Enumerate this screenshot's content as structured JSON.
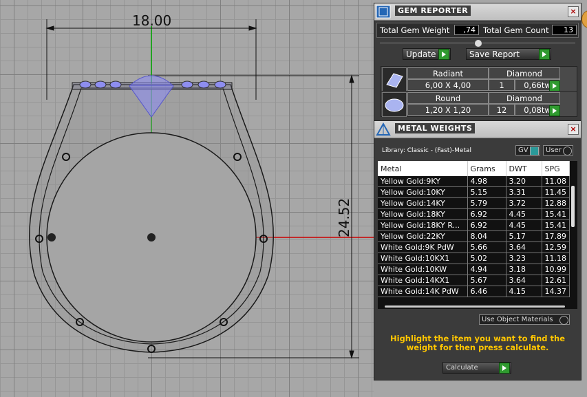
{
  "viewport": {
    "width_dimension": "18.00",
    "height_dimension": "24.52"
  },
  "gem_reporter": {
    "title": "GEM REPORTER",
    "close": "×",
    "total_weight_label": "Total Gem Weight",
    "total_weight_value": ",74",
    "total_count_label": "Total Gem Count",
    "total_count_value": "13",
    "update_label": "Update",
    "save_report_label": "Save Report",
    "gems": [
      {
        "cut": "Radiant",
        "material": "Diamond",
        "size": "6,00 X 4,00",
        "count": "1",
        "weight": "0,66tw"
      },
      {
        "cut": "Round",
        "material": "Diamond",
        "size": "1,20 X 1,20",
        "count": "12",
        "weight": "0,08tw"
      }
    ]
  },
  "metal_weights": {
    "title": "METAL WEIGHTS",
    "close": "×",
    "library": "Library: Classic - (Fast)-Metal",
    "gv_label": "GV",
    "user_label": "User",
    "columns": [
      "Metal",
      "Grams",
      "DWT",
      "SPG"
    ],
    "rows": [
      [
        "Yellow Gold:9KY",
        "4.98",
        "3.20",
        "11.08"
      ],
      [
        "Yellow Gold:10KY",
        "5.15",
        "3.31",
        "11.45"
      ],
      [
        "Yellow Gold:14KY",
        "5.79",
        "3.72",
        "12.88"
      ],
      [
        "Yellow Gold:18KY",
        "6.92",
        "4.45",
        "15.41"
      ],
      [
        "Yellow Gold:18KY R...",
        "6.92",
        "4.45",
        "15.41"
      ],
      [
        "Yellow Gold:22KY",
        "8.04",
        "5.17",
        "17.89"
      ],
      [
        "White Gold:9K PdW",
        "5.66",
        "3.64",
        "12.59"
      ],
      [
        "White Gold:10KX1",
        "5.02",
        "3.23",
        "11.18"
      ],
      [
        "White Gold:10KW",
        "4.94",
        "3.18",
        "10.99"
      ],
      [
        "White Gold:14KX1",
        "5.67",
        "3.64",
        "12.61"
      ],
      [
        "White Gold:14K PdW",
        "6.46",
        "4.15",
        "14.37"
      ]
    ],
    "use_object_materials": "Use Object Materials",
    "hint": "Highlight the item you want to find the weight for then press calculate.",
    "calculate_label": "Calculate"
  },
  "colors": {
    "accent_green": "#2f9a2f",
    "hint_yellow": "#ffc600",
    "gem_blue": "#8e8ef0"
  }
}
